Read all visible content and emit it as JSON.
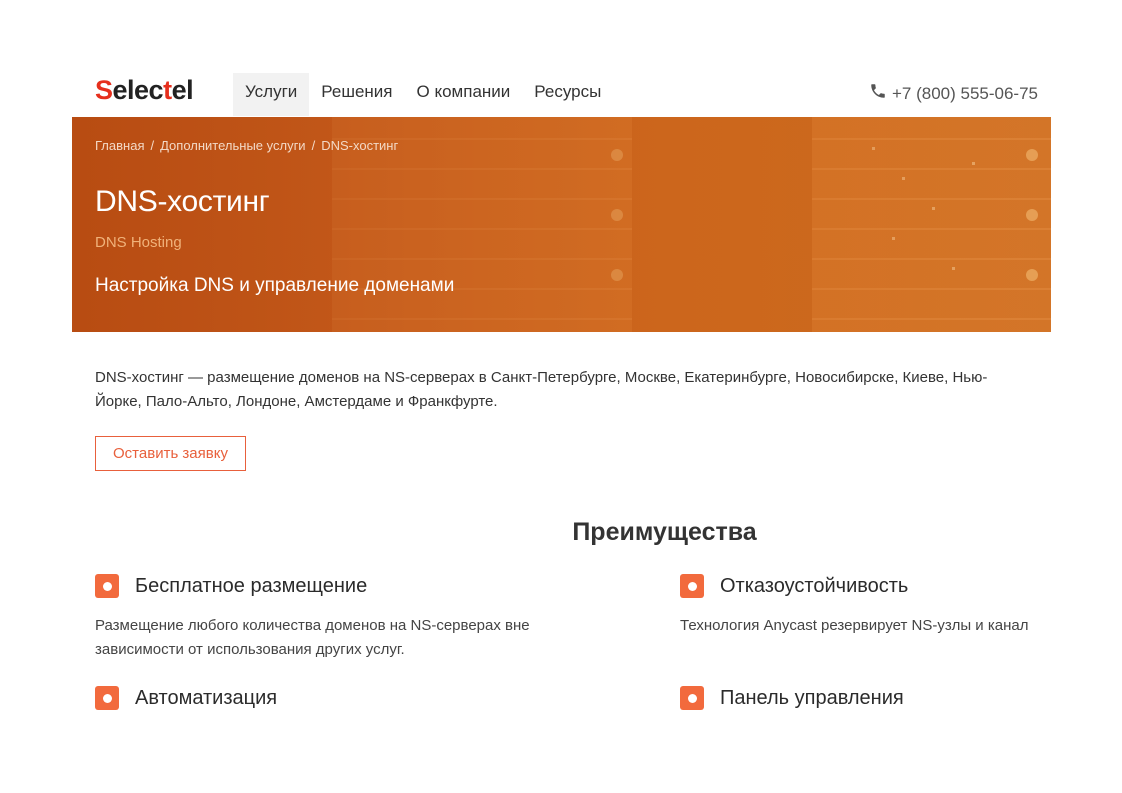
{
  "header": {
    "logo_text": "Selectel",
    "nav": [
      "Услуги",
      "Решения",
      "О компании",
      "Ресурсы"
    ],
    "active_nav": "Услуги",
    "phone": "+7 (800) 555-06-75",
    "phone_icon": "phone-icon"
  },
  "hero": {
    "breadcrumb": [
      "Главная",
      "Дополнительные услуги",
      "DNS-хостинг"
    ],
    "breadcrumb_separator": "/",
    "title": "DNS-хостинг",
    "subtitle_en": "DNS Hosting",
    "tagline": "Настройка DNS и управление доменами"
  },
  "intro": {
    "text": "DNS-хостинг — размещение доменов на NS-серверах в Санкт-Петербурге, Москве, Екатеринбурге, Новосибирске, Киеве, Нью-Йорке, Пало-Альто, Лондоне, Амстердаме и Франкфурте.",
    "cta_label": "Оставить заявку"
  },
  "advantages": {
    "title": "Преимущества",
    "items": [
      {
        "title": "Бесплатное размещение",
        "text": "Размещение любого количества доменов на NS-серверах вне зависимости от использования других услуг."
      },
      {
        "title": "Отказоустойчивость",
        "text": "Технология Anycast резервирует NS-узлы и канал"
      },
      {
        "title": "Автоматизация",
        "text": ""
      },
      {
        "title": "Панель управления",
        "text": ""
      }
    ]
  },
  "colors": {
    "brand_red": "#e62f1d",
    "accent_orange": "#f26a3d",
    "hero_orange": "#c95e18"
  }
}
